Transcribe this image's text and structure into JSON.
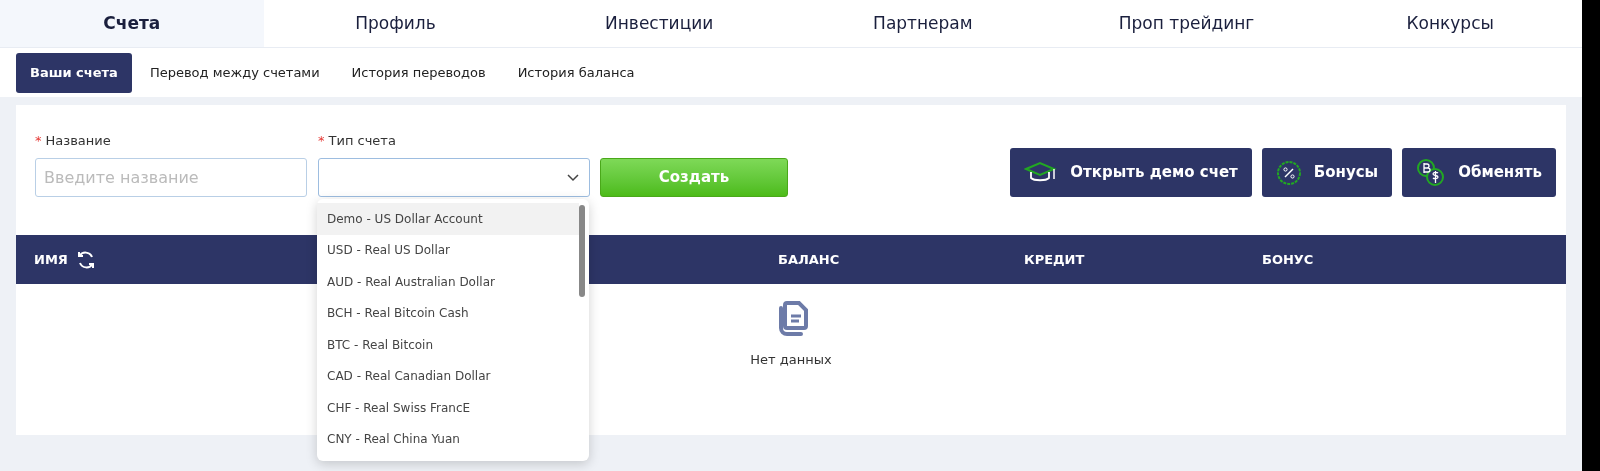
{
  "main_tabs": [
    {
      "label": "Счета",
      "selected": true
    },
    {
      "label": "Профиль",
      "selected": false
    },
    {
      "label": "Инвестиции",
      "selected": false
    },
    {
      "label": "Партнерам",
      "selected": false
    },
    {
      "label": "Проп трейдинг",
      "selected": false
    },
    {
      "label": "Конкурсы",
      "selected": false
    }
  ],
  "sub_tabs": [
    {
      "label": "Ваши счета",
      "selected": true
    },
    {
      "label": "Перевод между счетами",
      "selected": false
    },
    {
      "label": "История переводов",
      "selected": false
    },
    {
      "label": "История баланса",
      "selected": false
    }
  ],
  "form": {
    "name_label": "Название",
    "name_placeholder": "Введите название",
    "type_label": "Тип счета",
    "required_mark": "*",
    "create_button": "Создать"
  },
  "actions": [
    {
      "kind": "demo",
      "label": "Открыть демо счет"
    },
    {
      "kind": "bonus",
      "label": "Бонусы"
    },
    {
      "kind": "exchange",
      "label": "Обменять"
    }
  ],
  "table": {
    "columns": [
      {
        "label": "ИМЯ",
        "refresh": true
      },
      {
        "label": "БАЛАНС",
        "refresh": false
      },
      {
        "label": "КРЕДИТ",
        "refresh": false
      },
      {
        "label": "БОНУС",
        "refresh": false
      }
    ],
    "empty_text": "Нет данных"
  },
  "dropdown": {
    "options": [
      {
        "label": "Demo - US Dollar Account",
        "selected": true
      },
      {
        "label": "USD - Real US Dollar",
        "selected": false
      },
      {
        "label": "AUD - Real Australian Dollar",
        "selected": false
      },
      {
        "label": "BCH - Real Bitcoin Cash",
        "selected": false
      },
      {
        "label": "BTC - Real Bitcoin",
        "selected": false
      },
      {
        "label": "CAD - Real Canadian Dollar",
        "selected": false
      },
      {
        "label": "CHF - Real Swiss FrancE",
        "selected": false
      },
      {
        "label": "CNY - Real China Yuan",
        "selected": false
      }
    ]
  }
}
